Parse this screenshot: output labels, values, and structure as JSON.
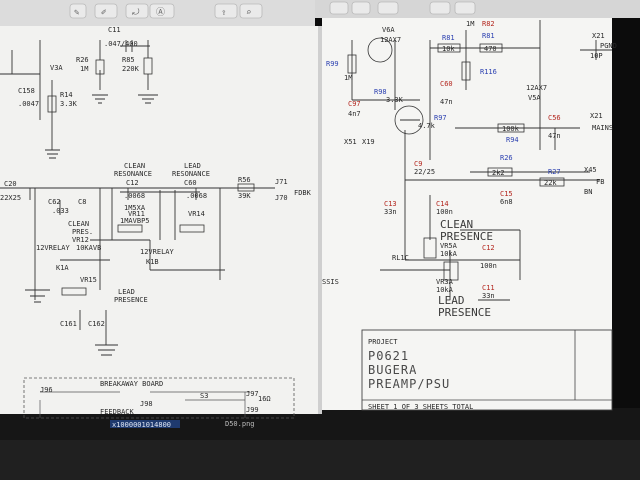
{
  "left_sheet": {
    "labels": {
      "lbl_v3a": "V3A",
      "lbl_r26": "R26",
      "lbl_1m_a": "1M",
      "lbl_c11": "C11",
      "lbl_c11v": ".047/400",
      "lbl_r85": "R85",
      "lbl_220k": "220K",
      "lbl_c158": "C158",
      "lbl_0047": ".0047",
      "lbl_r14": "R14",
      "lbl_33k_a": "3.3K",
      "lbl_clean_res": "CLEAN",
      "lbl_resonance1": "RESONANCE",
      "lbl_c12": "C12",
      "lbl_0068a": ".0068",
      "lbl_lead_res": "LEAD",
      "lbl_resonance2": "RESONANCE",
      "lbl_c60": "C60",
      "lbl_0068b": ".0068",
      "lbl_r56": "R56",
      "lbl_39k": "39K",
      "lbl_j71": "J71",
      "lbl_fdbk": "FDBK",
      "lbl_j70": "J70",
      "lbl_c20": "C20",
      "lbl_22x25": "22X25",
      "lbl_c62": "C62",
      "lbl_c8": "C8",
      "lbl_033": ".033",
      "lbl_vr11": "VR11",
      "lbl_1m5xa": "1M5XA",
      "lbl_1mavbp5": "1MAVBP5",
      "lbl_vr14": "VR14",
      "lbl_clean": "CLEAN",
      "lbl_pres": "PRES.",
      "lbl_vr12": "VR12",
      "lbl_12vrelay1": "12VRELAY",
      "lbl_10kavb": "10KAVB",
      "lbl_12vrelay2": "12VRELAY",
      "lbl_k1a": "K1A",
      "lbl_k1b": "K1B",
      "lbl_vr15": "VR15",
      "lbl_lead": "LEAD",
      "lbl_presence": "PRESENCE",
      "lbl_c161": "C161",
      "lbl_c162": "C162",
      "lbl_breakaway": "BREAKAWAY BOARD",
      "lbl_j96": "J96",
      "lbl_j97": "J97",
      "lbl_j98": "J98",
      "lbl_j99": "J99",
      "lbl_s3": "S3",
      "lbl_feedback": "FEEDBACK",
      "lbl_16": "16Ω"
    },
    "tab_caption": "D50.png",
    "file_label": "x1000001014800"
  },
  "right_sheet": {
    "labels": {
      "lbl_v6a": "V6A",
      "lbl_12ax7a": "12AX7",
      "lbl_r99": "R99",
      "lbl_1m_b": "1M",
      "lbl_r98": "R98",
      "lbl_33k_b": "3.3K",
      "lbl_c97": "C97",
      "lbl_4n7": "4n7",
      "lbl_r81": "R81",
      "lbl_10k": "10k",
      "lbl_r82": "R82",
      "lbl_470": "470",
      "lbl_1m_c": "1M",
      "lbl_r116": "R116",
      "lbl_c60r": "C60",
      "lbl_47n_a": "47n",
      "lbl_r97": "R97",
      "lbl_47k": "4.7k",
      "lbl_12ax7b": "12AX7",
      "lbl_v5a": "V5A",
      "lbl_100k": "100k",
      "lbl_r94": "R94",
      "lbl_c56": "C56",
      "lbl_47n_b": "47n",
      "lbl_x21a": "X21",
      "lbl_pgnd": "PGND",
      "lbl_10p": "10P",
      "lbl_x21b": "X21",
      "lbl_mains": "MAINS",
      "lbl_x51": "X51",
      "lbl_x19": "X19",
      "lbl_c9": "C9",
      "lbl_22_25": "22/25",
      "lbl_r26r": "R26",
      "lbl_2k2": "2k2",
      "lbl_c15": "C15",
      "lbl_6n8": "6n8",
      "lbl_r27": "R27",
      "lbl_22k": "22k",
      "lbl_x45": "X45",
      "lbl_fb": "FB",
      "lbl_bn": "BN",
      "lbl_c13": "C13",
      "lbl_33n_a": "33n",
      "lbl_c14": "C14",
      "lbl_100n_a": "100n",
      "lbl_clean_r": "CLEAN",
      "lbl_presence_r1": "PRESENCE",
      "lbl_vr5a": "VR5A",
      "lbl_10ka": "10kA",
      "lbl_c12r": "C12",
      "lbl_100n_b": "100n",
      "lbl_rl1c": "RL1C",
      "lbl_vr3a": "VR3A",
      "lbl_10ka_b": "10kA",
      "lbl_c11r": "C11",
      "lbl_33n_b": "33n",
      "lbl_lead_r": "LEAD",
      "lbl_presence_r2": "PRESENCE",
      "lbl_ssis": "SSIS"
    },
    "title_block": {
      "project_label": "PROJECT",
      "project_number": "P0621",
      "brand": "BUGERA",
      "title": "PREAMP/PSU",
      "sheet_line": "SHEET 1  OF 3  SHEETS TOTAL"
    }
  },
  "colors": {
    "paper": "#f4f4f2",
    "ink": "#2a2a2a",
    "blue_ref": "#2a3fb0",
    "red_ref": "#b3261e",
    "frame": "#0b0b0b"
  }
}
